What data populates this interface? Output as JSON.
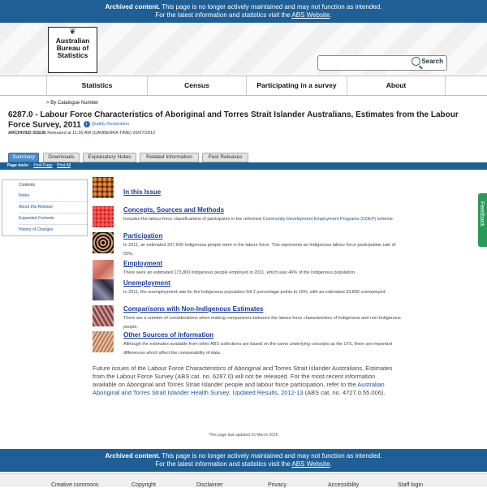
{
  "archived_notice": {
    "bold": "Archived content.",
    "text": " This page is no longer actively maintained and may not function as intended.",
    "line2_pre": "For the latest information and statistics visit the ",
    "link": "ABS Website",
    "line2_post": "."
  },
  "logo": {
    "line1": "Australian",
    "line2": "Bureau of",
    "line3": "Statistics"
  },
  "search": {
    "button_label": "Search",
    "placeholder": "",
    "value": ""
  },
  "nav": {
    "items": [
      "Statistics",
      "Census",
      "Participating in a survey",
      "About"
    ]
  },
  "breadcrumb": {
    "prefix": ">",
    "link": "By Catalogue Number"
  },
  "page": {
    "title": "6287.0 - Labour Force Characteristics of Aboriginal and Torres Strait Islander Australians, Estimates from the Labour Force Survey, 2011",
    "quality_declaration": "Quality Declaration",
    "issue_label": "ARCHIVED ISSUE",
    "issue_text": " Released at 11:30 AM (CANBERRA TIME) 26/07/2012"
  },
  "tabs": [
    "Summary",
    "Downloads",
    "Explanatory Notes",
    "Related Information",
    "Past Releases"
  ],
  "tools": {
    "label": "Page tools:",
    "print_page": "Print Page",
    "print_all": "Print All"
  },
  "sidebar": {
    "title": "Contents",
    "items": [
      "Notes",
      "About this Release",
      "Expanded Contents",
      "History of Changes"
    ]
  },
  "entries": [
    {
      "title": "In this Issue",
      "desc": ""
    },
    {
      "title": "Concepts, Sources and Methods",
      "desc_pre": "Includes the labour force classifications of participants in the reformed ",
      "desc_link": "Community Development Employment Programs (CDEP)",
      "desc_post": " scheme"
    },
    {
      "title": "Participation",
      "desc": "In 2011, an estimated 207,600 Indigenous people were in the labour force. This represents an Indigenous labour force participation rate of 55%."
    },
    {
      "title": "Employment",
      "desc": "There were an estimated 173,800 Indigenous people employed in 2011, which was 46% of the Indigenous population."
    },
    {
      "title": "Unemployment",
      "desc": "In 2011, the unemployment rate for the Indigenous population fell 2 percentage points to 16%, with an estimated 33,800 unemployed."
    },
    {
      "title": "Comparisons with Non-Indigenous Estimates",
      "desc": "There are a number of considerations when making comparisons between the labour force characteristics of Indigenous and non-Indigenous people."
    },
    {
      "title": "Other Sources of Information",
      "desc": "Although the estimates available from other ABS collections are based on the same underlying concepts as the LFS, there are important differences which affect the comparability of data."
    }
  ],
  "future": {
    "text": "Future issues of the Labour Force Characteristics of Aboriginal and Torres Strait Islander Australians, Estimates from the Labour Force Survey (ABS cat. no. 6287.0) will not be released. For the most recent information available on Aboriginal and Torres Strait Islander people and labour force participation, refer to the ",
    "link": "Australian Aboriginal and Torres Strait Islander Health Survey: Updated Results, 2012-13",
    "post": " (ABS cat. no. 4727.0.55.006)."
  },
  "updated": "This page last updated 15 March 2016",
  "footer": {
    "links": [
      "Creative commons",
      "Copyright",
      "Disclaimer",
      "Privacy",
      "Accessibility",
      "Staff login"
    ]
  },
  "feedback": "Feedback"
}
